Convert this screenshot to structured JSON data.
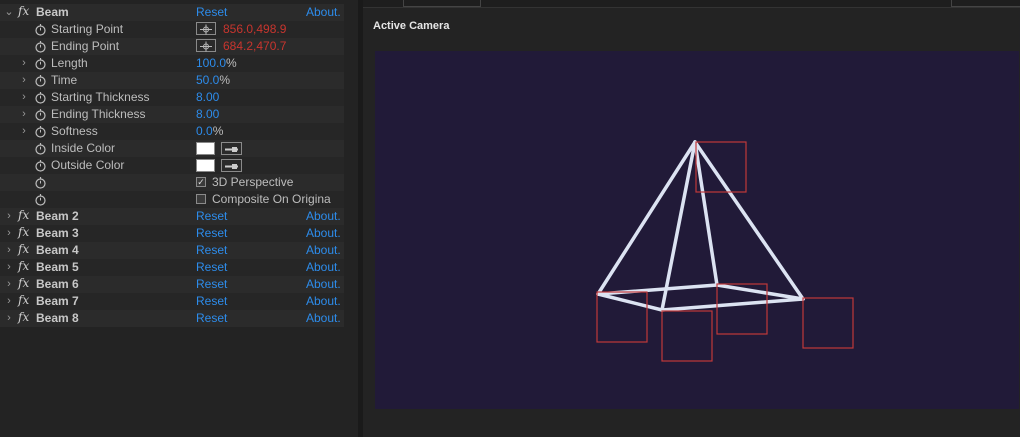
{
  "effects": {
    "main": {
      "name": "Beam",
      "reset_label": "Reset",
      "about_label": "About."
    },
    "collapsed": [
      {
        "name": "Beam 2",
        "reset_label": "Reset",
        "about_label": "About."
      },
      {
        "name": "Beam 3",
        "reset_label": "Reset",
        "about_label": "About."
      },
      {
        "name": "Beam 4",
        "reset_label": "Reset",
        "about_label": "About."
      },
      {
        "name": "Beam 5",
        "reset_label": "Reset",
        "about_label": "About."
      },
      {
        "name": "Beam 6",
        "reset_label": "Reset",
        "about_label": "About."
      },
      {
        "name": "Beam 7",
        "reset_label": "Reset",
        "about_label": "About."
      },
      {
        "name": "Beam 8",
        "reset_label": "Reset",
        "about_label": "About."
      }
    ]
  },
  "properties": {
    "starting_point": {
      "label": "Starting Point",
      "value": "856.0,498.9"
    },
    "ending_point": {
      "label": "Ending Point",
      "value": "684.2,470.7"
    },
    "length": {
      "label": "Length",
      "value": "100.0",
      "unit": "%"
    },
    "time": {
      "label": "Time",
      "value": "50.0",
      "unit": "%"
    },
    "starting_thickness": {
      "label": "Starting Thickness",
      "value": "8.00"
    },
    "ending_thickness": {
      "label": "Ending Thickness",
      "value": "8.00"
    },
    "softness": {
      "label": "Softness",
      "value": "0.0",
      "unit": "%"
    },
    "inside_color": {
      "label": "Inside Color",
      "color": "#ffffff"
    },
    "outside_color": {
      "label": "Outside Color",
      "color": "#ffffff"
    },
    "perspective_3d": {
      "label": "3D Perspective",
      "checked": true
    },
    "composite_on_original": {
      "label": "Composite On Origina",
      "checked": false
    }
  },
  "viewer": {
    "title": "Active Camera",
    "background_color": "#211a38",
    "wire_color": "#dce3f2",
    "box_color": "#c0383a"
  },
  "colors": {
    "link_blue": "#2d8ceb",
    "point_red": "#c8352e"
  }
}
